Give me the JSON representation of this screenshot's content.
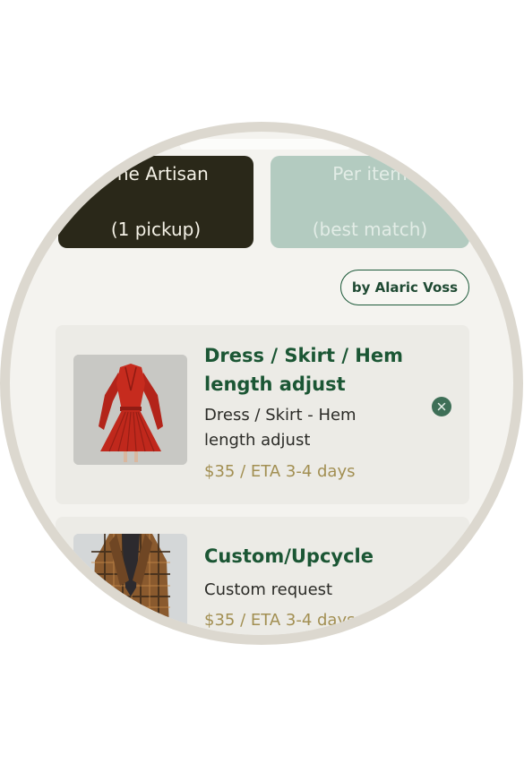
{
  "segmented": {
    "one_artisan_line1": "One Artisan",
    "one_artisan_line2": "(1 pickup)",
    "per_item_line1": "Per item",
    "per_item_line2": "(best match)"
  },
  "artisan_filter": {
    "label": "by Alaric Voss"
  },
  "items": [
    {
      "title": "Dress / Skirt / Hem length adjust",
      "description": "Dress / Skirt - Hem length adjust",
      "price": "$35 / ETA 3-4 days",
      "image": "red-dress-image"
    },
    {
      "title": "Custom/Upcycle",
      "description": "Custom request",
      "price": "$35 / ETA 3-4 days",
      "image": "plaid-blazer-image"
    }
  ],
  "colors": {
    "active_segment": "#2a2819",
    "inactive_segment": "#b3cbc0",
    "title_green": "#1b5634",
    "price_gold": "#a28f52",
    "remove_button": "#3e6f57"
  }
}
